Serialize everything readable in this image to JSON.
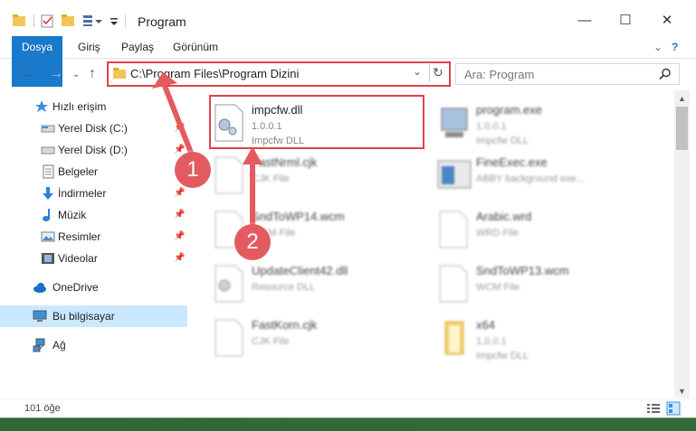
{
  "window": {
    "title": "Program"
  },
  "ribbon": {
    "tabs": [
      "Dosya",
      "Giriş",
      "Paylaş",
      "Görünüm"
    ]
  },
  "address": {
    "path": "C:\\Program Files\\Program Dizini"
  },
  "search": {
    "placeholder": "Ara: Program"
  },
  "sidebar": {
    "items": [
      {
        "label": "Hızlı erişim",
        "icon": "star-icon",
        "pinned": false
      },
      {
        "label": "Yerel Disk (C:)",
        "icon": "drive-icon",
        "pinned": true
      },
      {
        "label": "Yerel Disk (D:)",
        "icon": "drive-icon",
        "pinned": true
      },
      {
        "label": "Belgeler",
        "icon": "documents-icon",
        "pinned": true
      },
      {
        "label": "İndirmeler",
        "icon": "download-icon",
        "pinned": true
      },
      {
        "label": "Müzik",
        "icon": "music-icon",
        "pinned": true
      },
      {
        "label": "Resimler",
        "icon": "pictures-icon",
        "pinned": true
      },
      {
        "label": "Videolar",
        "icon": "video-icon",
        "pinned": true
      },
      {
        "label": "OneDrive",
        "icon": "cloud-icon",
        "pinned": false
      },
      {
        "label": "Bu bilgisayar",
        "icon": "computer-icon",
        "pinned": false
      },
      {
        "label": "Ağ",
        "icon": "network-icon",
        "pinned": false
      }
    ]
  },
  "files": [
    {
      "name": "impcfw.dll",
      "line1": "1.0.0.1",
      "line2": "Impcfw DLL"
    },
    {
      "name": "program.exe",
      "line1": "1.0.0.1",
      "line2": "Impcfw DLL"
    },
    {
      "name": "FastNrml.cjk",
      "line1": "CJK File",
      "line2": ""
    },
    {
      "name": "FineExec.exe",
      "line1": "ABBY background exe...",
      "line2": ""
    },
    {
      "name": "SndToWP14.wcm",
      "line1": "WCM File",
      "line2": ""
    },
    {
      "name": "Arabic.wrd",
      "line1": "WRD File",
      "line2": ""
    },
    {
      "name": "UpdateClient42.dll",
      "line1": "Resource DLL",
      "line2": ""
    },
    {
      "name": "SndToWP13.wcm",
      "line1": "WCM File",
      "line2": ""
    },
    {
      "name": "FastKorn.cjk",
      "line1": "CJK File",
      "line2": ""
    },
    {
      "name": "x64",
      "line1": "1.0.0.1",
      "line2": "Impcfw DLL"
    }
  ],
  "status": {
    "count": "101 öğe"
  },
  "callouts": [
    "1",
    "2"
  ],
  "colors": {
    "accent": "#1979ca",
    "highlight": "#e0424a",
    "badge": "#e35b61"
  }
}
